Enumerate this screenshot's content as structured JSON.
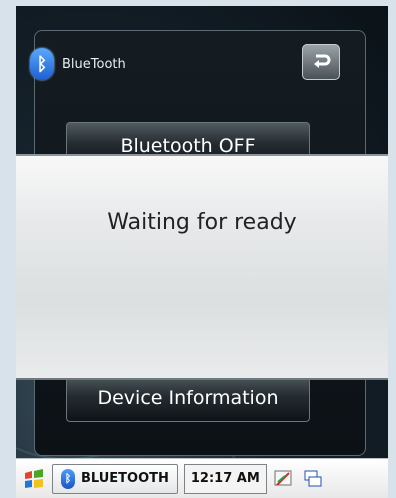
{
  "app": {
    "title": "BlueTooth",
    "back_icon": "back-arrow-icon"
  },
  "menu": {
    "bluetooth_off_label": "Bluetooth OFF",
    "device_information_label": "Device Information"
  },
  "dialog": {
    "message": "Waiting for ready"
  },
  "taskbar": {
    "start_icon": "windows-flag-icon",
    "active_app_label": "BLUETOOTH",
    "time": "12:17 AM",
    "tray_icons": [
      "connectivity-icon",
      "multitask-windows-icon"
    ]
  },
  "colors": {
    "accent": "#1d5fd0",
    "dialog_bg": "#e7e9ea",
    "screen_bg": "#0b1218"
  }
}
